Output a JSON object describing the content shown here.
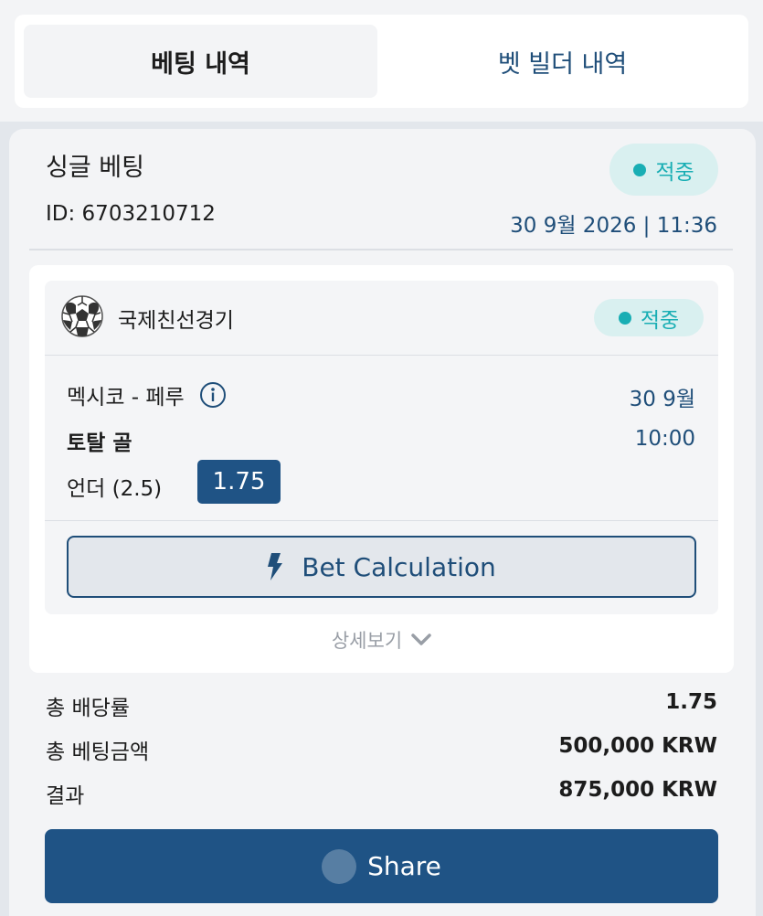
{
  "tabs": {
    "active_label": "베팅 내역",
    "inactive_label": "벳 빌더 내역"
  },
  "bet": {
    "type": "싱글 베팅",
    "id": "ID: 6703210712",
    "status": "적중",
    "datetime": "30 9월 2026 | 11:36"
  },
  "event": {
    "league": "국제친선경기",
    "status": "적중",
    "match": "멕시코 - 페루",
    "date": "30 9월",
    "market": "토탈 골",
    "time": "10:00",
    "selection": "언더 (2.5)",
    "odds": "1.75",
    "calc_label": "Bet Calculation",
    "icons": {
      "sport": "soccer-ball-icon",
      "info": "info-icon",
      "calc": "lightning-icon"
    }
  },
  "details_label": "상세보기",
  "totals": {
    "odds_label": "총 배당률",
    "odds_value": "1.75",
    "stake_label": "총 베팅금액",
    "stake_value": "500,000 KRW",
    "result_label": "결과",
    "result_value": "875,000 KRW"
  },
  "share_label": "Share",
  "colors": {
    "accent": "#1f5385",
    "success": "#19aeb4",
    "success_bg": "#d9f0f0",
    "link_text": "#1f4e79"
  }
}
